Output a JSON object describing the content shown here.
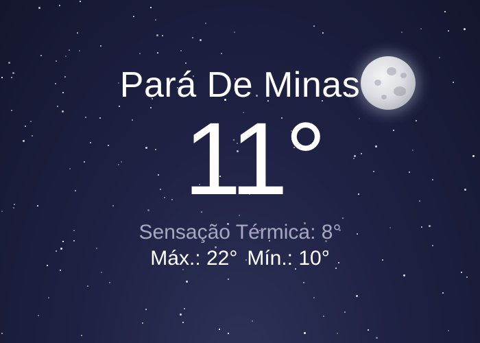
{
  "location": {
    "city": "Pará De Minas"
  },
  "current": {
    "temperature": "11°",
    "feels_like_label": "Sensação Térmica: 8°"
  },
  "range": {
    "max_label": "Máx.: 22°",
    "min_label": "Mín.: 10°"
  },
  "background": {
    "theme": "night-sky",
    "icon": "full-moon-icon",
    "sky_color": "#1f2244",
    "secondary_text_color": "#a6a8c0"
  }
}
